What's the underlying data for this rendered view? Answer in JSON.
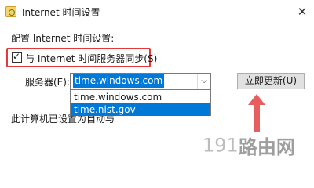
{
  "window": {
    "title": "Internet 时间设置",
    "close_glyph": "✕"
  },
  "config_label": "配置 Internet 时间设置:",
  "sync": {
    "checked": true,
    "check_glyph": "✓",
    "label": "与 Internet 时间服务器同步(S)"
  },
  "server": {
    "label": "服务器(E):",
    "value": "time.windows.com",
    "arrow_glyph": "⌵",
    "options": [
      "time.windows.com",
      "time.nist.gov"
    ],
    "highlighted_option": "time.nist.gov"
  },
  "update_button_label": "立即更新(U)",
  "status_text": "此计算机已设置为自动与",
  "watermark": {
    "number": "191",
    "chars": [
      "路",
      "由",
      "网"
    ]
  },
  "colors": {
    "highlight_blue": "#0078d7",
    "annotation_red": "#e23a3a"
  }
}
